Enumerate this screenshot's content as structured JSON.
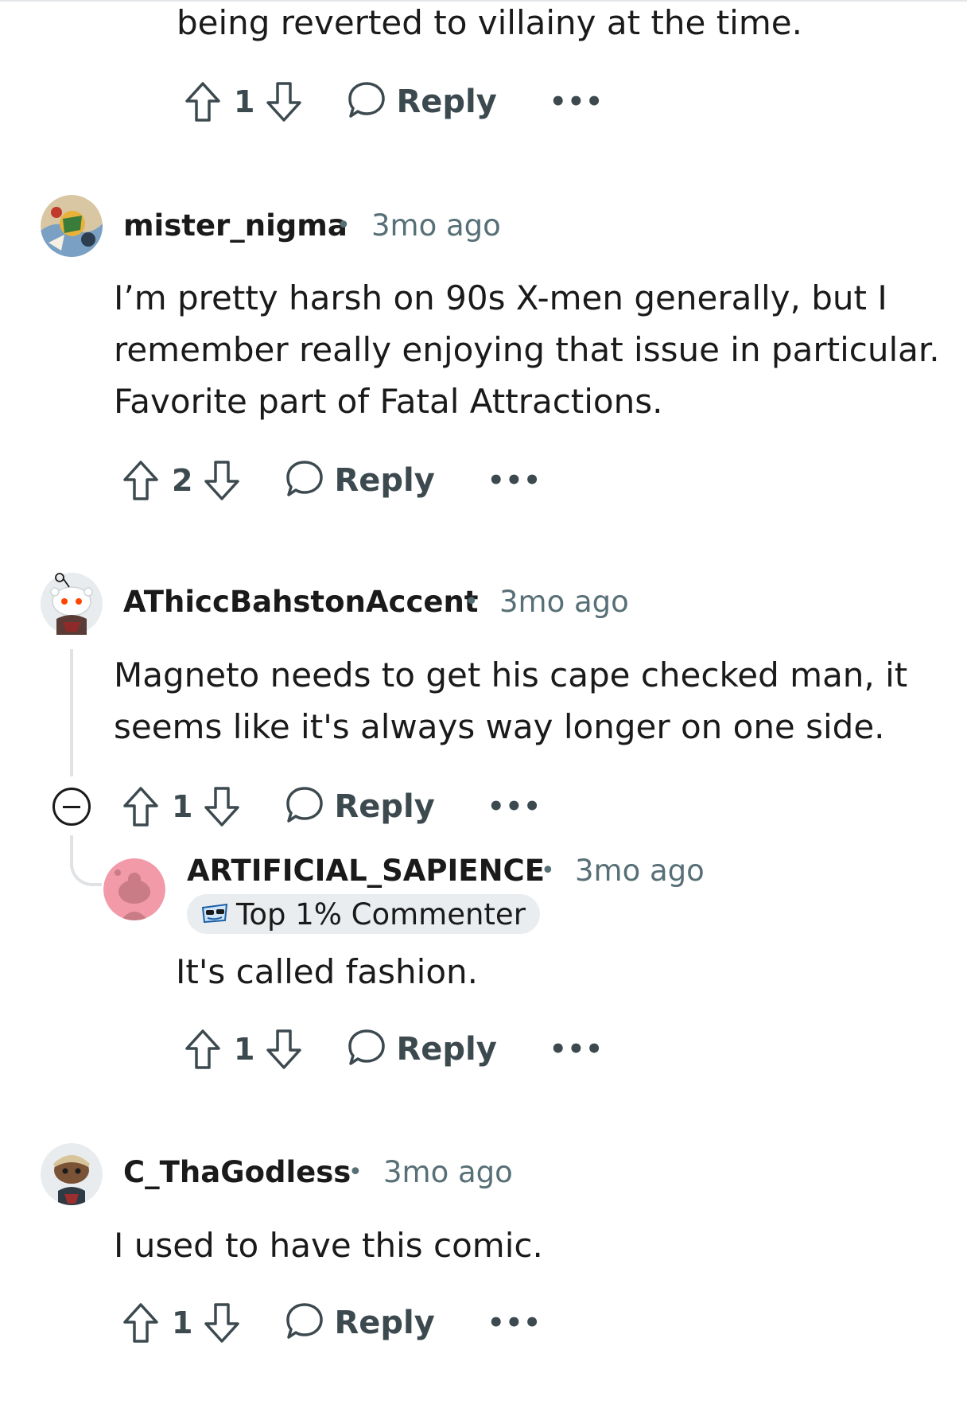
{
  "comments": [
    {
      "id": "c0",
      "body": "being reverted to villainy at the time.",
      "votes": "1",
      "reply_label": "Reply",
      "more_label": "•••"
    },
    {
      "id": "c1",
      "username": "mister_nigma",
      "separator": "•",
      "time": "3mo ago",
      "body": "I’m pretty harsh on 90s X-men generally, but I\nremember really enjoying that issue in particular.\nFavorite part of Fatal Attractions.",
      "votes": "2",
      "reply_label": "Reply",
      "more_label": "•••"
    },
    {
      "id": "c2",
      "username": "AThiccBahstonAccent",
      "separator": "•",
      "time": "3mo ago",
      "body": "Magneto needs to get his cape checked man, it\nseems like it's always way longer on one side.",
      "votes": "1",
      "reply_label": "Reply",
      "more_label": "•••"
    },
    {
      "id": "c3",
      "username": "ARTIFICIAL_SAPIENCE",
      "separator": "•",
      "time": "3mo ago",
      "badge": "Top 1% Commenter",
      "body": "It's called fashion.",
      "votes": "1",
      "reply_label": "Reply",
      "more_label": "•••"
    },
    {
      "id": "c4",
      "username": "C_ThaGodless",
      "separator": "•",
      "time": "3mo ago",
      "body": "I used to have this comic.",
      "votes": "1",
      "reply_label": "Reply",
      "more_label": "•••"
    }
  ],
  "icons": {
    "upvote": "upvote-arrow-icon",
    "downvote": "downvote-arrow-icon",
    "reply": "speech-bubble-icon",
    "more": "ellipsis-icon",
    "collapse": "minus-circle-icon",
    "badge": "sunglasses-icon"
  },
  "colors": {
    "text": "#1a1a1b",
    "meta": "#576f76",
    "action": "#3c4a50",
    "thread_line": "#e0e3e5",
    "badge_bg": "#eaedef",
    "avatar_pink": "#f29aa8"
  }
}
